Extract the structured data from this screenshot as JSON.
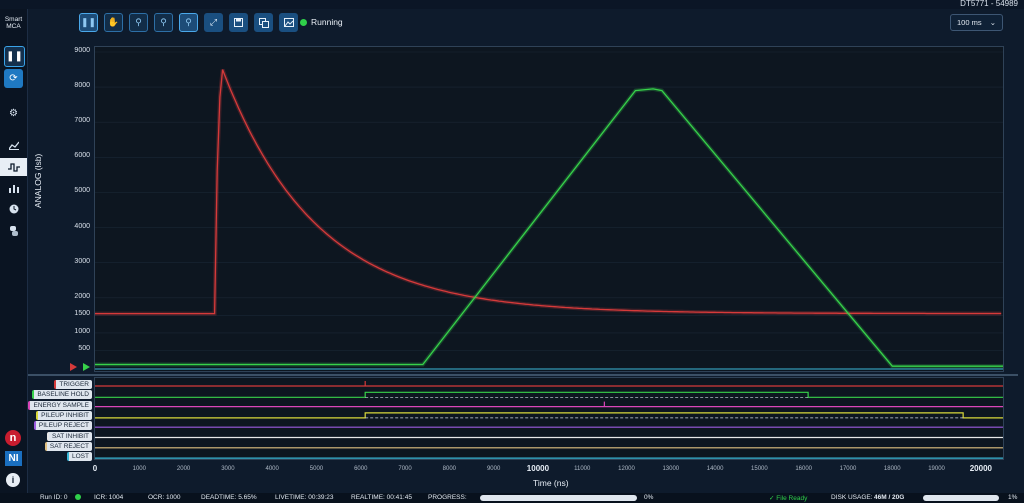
{
  "window": {
    "device": "DT5771 - 54989"
  },
  "sidebar": {
    "brand_line1": "Smart",
    "brand_line2": "MCA",
    "pause_icon": "pause-icon",
    "refresh_icon": "refresh-icon",
    "items": [
      {
        "icon": "gear-icon"
      },
      {
        "icon": "line-chart-icon"
      },
      {
        "icon": "waveform-icon",
        "active": true
      },
      {
        "icon": "bar-chart-icon"
      },
      {
        "icon": "clock-icon"
      },
      {
        "icon": "python-icon"
      }
    ],
    "logo_n": "n",
    "logo_ni": "NI",
    "info": "i"
  },
  "toolbar": {
    "buttons": [
      "pause-icon",
      "hand-pan-icon",
      "zoom-x-icon",
      "zoom-y-icon",
      "zoom-icon",
      "fit-icon",
      "save-icon",
      "copy-icon",
      "image-icon"
    ],
    "status": "Running",
    "status_color": "#2fd04a",
    "interval": "100 ms"
  },
  "chart_data": {
    "type": "line",
    "ylabel": "ANALOG (lsb)",
    "xlabel": "Time (ns)",
    "ylim": [
      0,
      9000
    ],
    "xlim": [
      0,
      20500
    ],
    "yticks": [
      "9000",
      "8000",
      "7000",
      "6000",
      "5000",
      "4000",
      "3000",
      "2000",
      "1500",
      "1000",
      "500"
    ],
    "xticks": [
      "0",
      "1000",
      "2000",
      "3000",
      "4000",
      "5000",
      "6000",
      "7000",
      "8000",
      "9000",
      "10000",
      "11000",
      "12000",
      "13000",
      "14000",
      "15000",
      "16000",
      "17000",
      "18000",
      "19000",
      "20000"
    ],
    "series": [
      {
        "color": "#d63a3a",
        "x": [
          0,
          2700,
          2720,
          2800,
          2900,
          3200,
          3600,
          4200,
          5000,
          6000,
          7500,
          9000,
          11000,
          14000,
          17000,
          20500
        ],
        "y": [
          1550,
          1550,
          5000,
          8200,
          8600,
          7900,
          6800,
          5600,
          4300,
          3300,
          2500,
          2050,
          1750,
          1600,
          1560,
          1550
        ]
      },
      {
        "color": "#37d24a",
        "x": [
          0,
          7400,
          12200,
          12600,
          12800,
          18000,
          20500
        ],
        "y": [
          100,
          100,
          7900,
          7950,
          7900,
          50,
          50
        ]
      }
    ],
    "digital": [
      {
        "label": "TRIGGER",
        "color": "#d63a3a"
      },
      {
        "label": "BASELINE HOLD",
        "color": "#37d24a"
      },
      {
        "label": "ENERGY SAMPLE",
        "color": "#d946b8"
      },
      {
        "label": "PILEUP INHIBIT",
        "color": "#d9d93a"
      },
      {
        "label": "PILEUP REJECT",
        "color": "#9b5be0"
      },
      {
        "label": "SAT INHIBIT",
        "color": "#e8e8e8"
      },
      {
        "label": "SAT REJECT",
        "color": "#e0c080"
      },
      {
        "label": "LOST",
        "color": "#3ab8d8"
      }
    ]
  },
  "statusbar": {
    "run_id": "Run ID: 0",
    "icr": "ICR: 1004",
    "ocr": "OCR: 1000",
    "deadtime": "DEADTIME: 5.65%",
    "livetime": "LIVETIME: 00:39:23",
    "realtime": "REALTIME: 00:41:45",
    "progress_label": "PROGRESS:",
    "progress_value": "0%",
    "file": "✓ File Ready",
    "disk_label": "DISK USAGE:",
    "disk_value": "46M / 20G",
    "disk_pct": "1%"
  }
}
